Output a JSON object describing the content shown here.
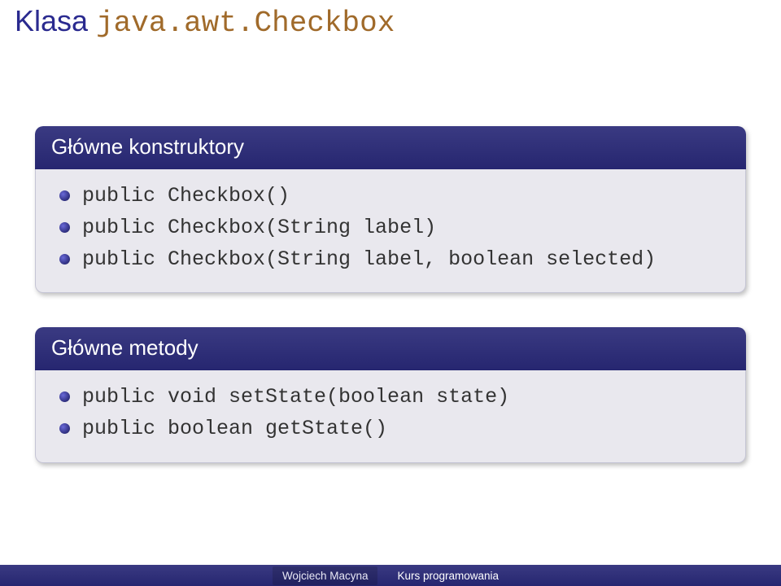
{
  "title": {
    "prefix": "Klasa ",
    "code": "java.awt.Checkbox"
  },
  "blocks": [
    {
      "header": "Główne konstruktory",
      "items": [
        "public Checkbox()",
        "public Checkbox(String label)",
        "public Checkbox(String label, boolean selected)"
      ]
    },
    {
      "header": "Główne metody",
      "items": [
        "public void setState(boolean state)",
        "public boolean getState()"
      ]
    }
  ],
  "footer": {
    "author": "Wojciech Macyna",
    "course": "Kurs programowania"
  }
}
